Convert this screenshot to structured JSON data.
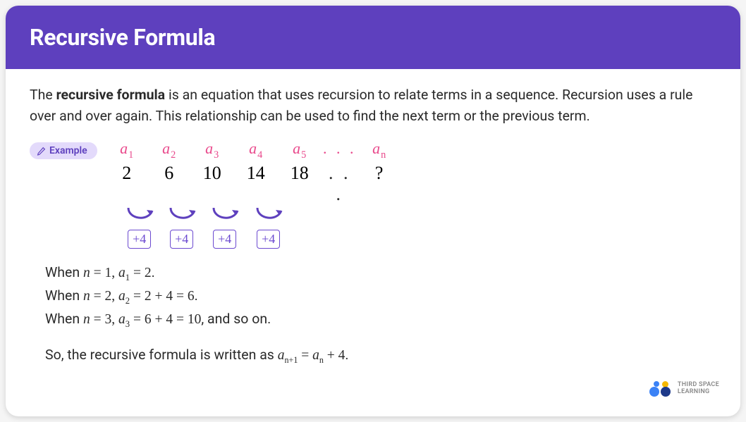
{
  "title": "Recursive Formula",
  "intro_prefix": "The ",
  "intro_bold": "recursive formula",
  "intro_rest": " is an equation that uses recursion to relate terms in a sequence. Recursion uses a rule over and over again. This relationship can be used to find the next term or the previous term.",
  "example_label": "Example",
  "sequence": {
    "labels": [
      "a",
      "a",
      "a",
      "a",
      "a",
      "a"
    ],
    "subs": [
      "1",
      "2",
      "3",
      "4",
      "5",
      "n"
    ],
    "values": [
      "2",
      "6",
      "10",
      "14",
      "18",
      "?"
    ],
    "dots": ". . .",
    "ops": [
      "+4",
      "+4",
      "+4",
      "+4"
    ]
  },
  "explain": {
    "line1_pre": "When ",
    "line1_math": "n = 1, a₁ = 2",
    "line1_post": ".",
    "line2_pre": "When ",
    "line2_math": "n = 2, a₂ = 2 + 4 = 6",
    "line2_post": ".",
    "line3_pre": "When ",
    "line3_math": "n = 3, a₃ = 6 + 4 = 10",
    "line3_post": ", and so on."
  },
  "conclusion_pre": "So, the recursive formula is written as ",
  "conclusion_math": "aₙ₊₁ = aₙ + 4",
  "conclusion_post": ".",
  "logo": {
    "line1": "THIRD SPACE",
    "line2": "LEARNING"
  }
}
